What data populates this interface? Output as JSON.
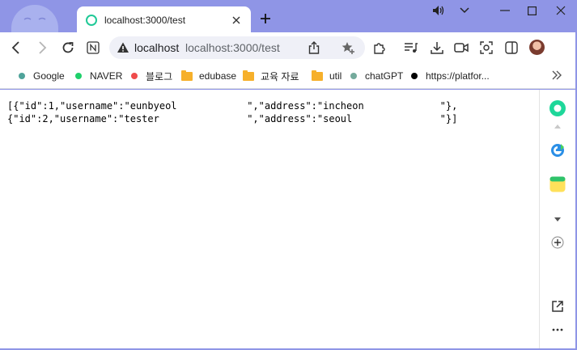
{
  "browser": {
    "tab": {
      "title": "localhost:3000/test"
    },
    "address": {
      "host": "localhost",
      "url": "localhost:3000/test"
    }
  },
  "bookmarks": [
    {
      "label": "Google",
      "icon": "google-dot-icon",
      "color": "#4fa39a"
    },
    {
      "label": "NAVER",
      "icon": "naver-dot-icon",
      "color": "#1fd06b"
    },
    {
      "label": "블로그",
      "icon": "blog-dot-icon",
      "color": "#ef4b4b"
    },
    {
      "label": "edubase",
      "icon": "folder-icon",
      "color": "#f6b02b"
    },
    {
      "label": "교육 자료",
      "icon": "folder-icon",
      "color": "#f6b02b"
    },
    {
      "label": "util",
      "icon": "folder-icon",
      "color": "#f6b02b"
    },
    {
      "label": "chatGPT",
      "icon": "chatgpt-dot-icon",
      "color": "#74aa9c"
    },
    {
      "label": "https://platfor...",
      "icon": "platform-dot-icon",
      "color": "#000000"
    }
  ],
  "content": {
    "lines": [
      "[{\"id\":1,\"username\":\"eunbyeol            \",\"address\":\"incheon             \"},",
      "{\"id\":2,\"username\":\"tester               \",\"address\":\"seoul               \"}]"
    ]
  },
  "colors": {
    "frame": "#8f95e6",
    "accent": "#20c997"
  }
}
